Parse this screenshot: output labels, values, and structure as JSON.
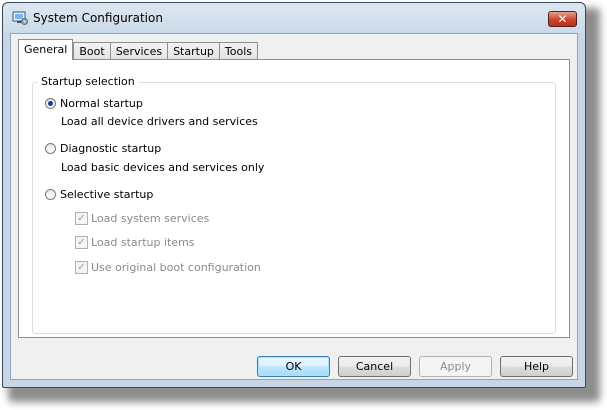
{
  "window": {
    "title": "System Configuration",
    "close_glyph": "✕",
    "icon": "msconfig-icon"
  },
  "tabs": [
    {
      "label": "General",
      "active": true
    },
    {
      "label": "Boot",
      "active": false
    },
    {
      "label": "Services",
      "active": false
    },
    {
      "label": "Startup",
      "active": false
    },
    {
      "label": "Tools",
      "active": false
    }
  ],
  "general": {
    "group_label": "Startup selection",
    "options": [
      {
        "label": "Normal startup",
        "description": "Load all device drivers and services",
        "selected": true
      },
      {
        "label": "Diagnostic startup",
        "description": "Load basic devices and services only",
        "selected": false
      },
      {
        "label": "Selective startup",
        "description": "",
        "selected": false
      }
    ],
    "selective_items": [
      {
        "label": "Load system services",
        "checked": true,
        "enabled": false
      },
      {
        "label": "Load startup items",
        "checked": true,
        "enabled": false
      },
      {
        "label": "Use original boot configuration",
        "checked": true,
        "enabled": false
      }
    ]
  },
  "buttons": {
    "ok": "OK",
    "cancel": "Cancel",
    "apply": "Apply",
    "help": "Help"
  },
  "colors": {
    "title_gradient_top": "#dde7f1",
    "close_red": "#c9452c",
    "radio_dot": "#1a3e8c",
    "default_button": "#bee6fd",
    "disabled_text": "#8a8a8a"
  }
}
